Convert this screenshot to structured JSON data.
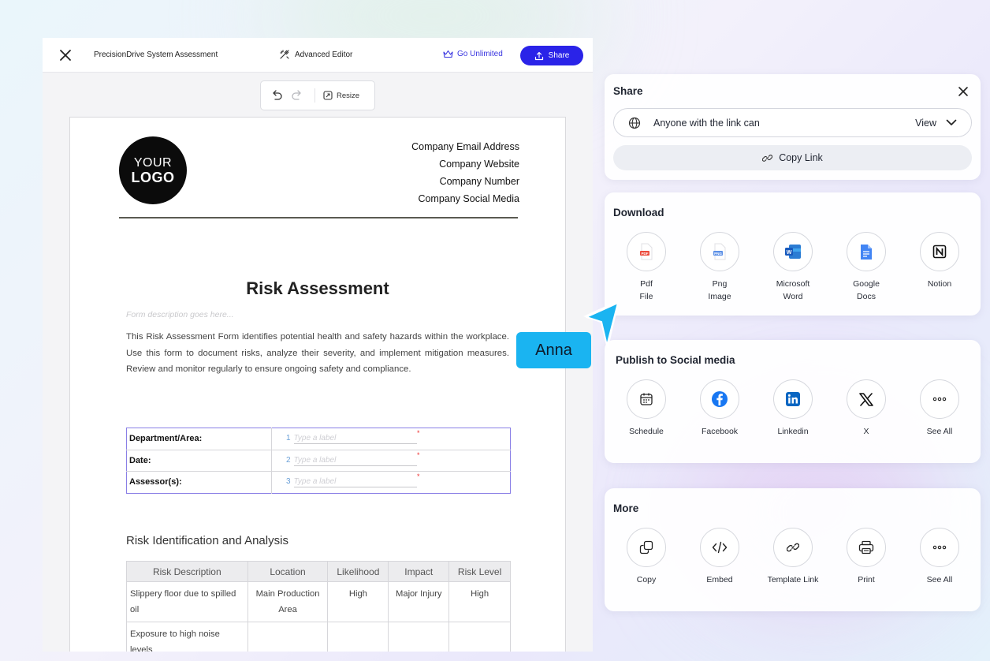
{
  "editor": {
    "doc_title": "PrecisionDrive System Assessment",
    "advanced_editor_label": "Advanced Editor",
    "go_unlimited_label": "Go Unlimited",
    "share_label": "Share",
    "resize_label": "Resize"
  },
  "document": {
    "logo_line1": "YOUR",
    "logo_line2": "LOGO",
    "company": {
      "email": "Company Email Address",
      "website": "Company Website",
      "number": "Company Number",
      "social": "Company Social Media"
    },
    "title": "Risk Assessment",
    "description_placeholder": "Form description goes here...",
    "intro": "This Risk Assessment Form identifies potential health and safety hazards within the workplace. Use this form to document risks, analyze their severity, and implement mitigation measures. Review and monitor regularly to ensure ongoing safety and compliance.",
    "info_fields": [
      {
        "label": "Department/Area:",
        "num": "1",
        "placeholder": "Type a label",
        "req": "*"
      },
      {
        "label": "Date:",
        "num": "2",
        "placeholder": "Type a label",
        "req": "*"
      },
      {
        "label": "Assessor(s):",
        "num": "3",
        "placeholder": "Type a label",
        "req": "*"
      }
    ],
    "section_title": "Risk Identification and Analysis",
    "risk_table": {
      "headers": [
        "Risk Description",
        "Location",
        "Likelihood",
        "Impact",
        "Risk Level"
      ],
      "rows": [
        [
          "Slippery floor due to spilled oil",
          "Main Production Area",
          "High",
          "Major Injury",
          "High"
        ],
        [
          "Exposure to high noise levels",
          "",
          "",
          "",
          ""
        ]
      ]
    }
  },
  "share_panel": {
    "title": "Share",
    "link_access": "Anyone with the link can",
    "link_permission": "View",
    "copy_link_label": "Copy Link"
  },
  "download_panel": {
    "title": "Download",
    "options": [
      {
        "label": "Pdf\nFile",
        "icon": "pdf-icon"
      },
      {
        "label": "Png\nImage",
        "icon": "png-icon"
      },
      {
        "label": "Microsoft\nWord",
        "icon": "word-icon"
      },
      {
        "label": "Google\nDocs",
        "icon": "google-docs-icon"
      },
      {
        "label": "Notion",
        "icon": "notion-icon"
      }
    ]
  },
  "social_panel": {
    "title": "Publish to Social media",
    "options": [
      {
        "label": "Schedule",
        "icon": "calendar-icon"
      },
      {
        "label": "Facebook",
        "icon": "facebook-icon"
      },
      {
        "label": "Linkedin",
        "icon": "linkedin-icon"
      },
      {
        "label": "X",
        "icon": "x-icon"
      },
      {
        "label": "See All",
        "icon": "more-dots-icon"
      }
    ]
  },
  "more_panel": {
    "title": "More",
    "options": [
      {
        "label": "Copy",
        "icon": "copy-icon"
      },
      {
        "label": "Embed",
        "icon": "code-icon"
      },
      {
        "label": "Template Link",
        "icon": "link-icon"
      },
      {
        "label": "Print",
        "icon": "printer-icon"
      },
      {
        "label": "See All",
        "icon": "more-dots-icon"
      }
    ]
  },
  "cursor": {
    "label": "Anna",
    "color": "#1ab4f1"
  },
  "colors": {
    "accent": "#2a23e8",
    "cursor": "#1ab4f1",
    "field_border": "#8a7fe6"
  }
}
